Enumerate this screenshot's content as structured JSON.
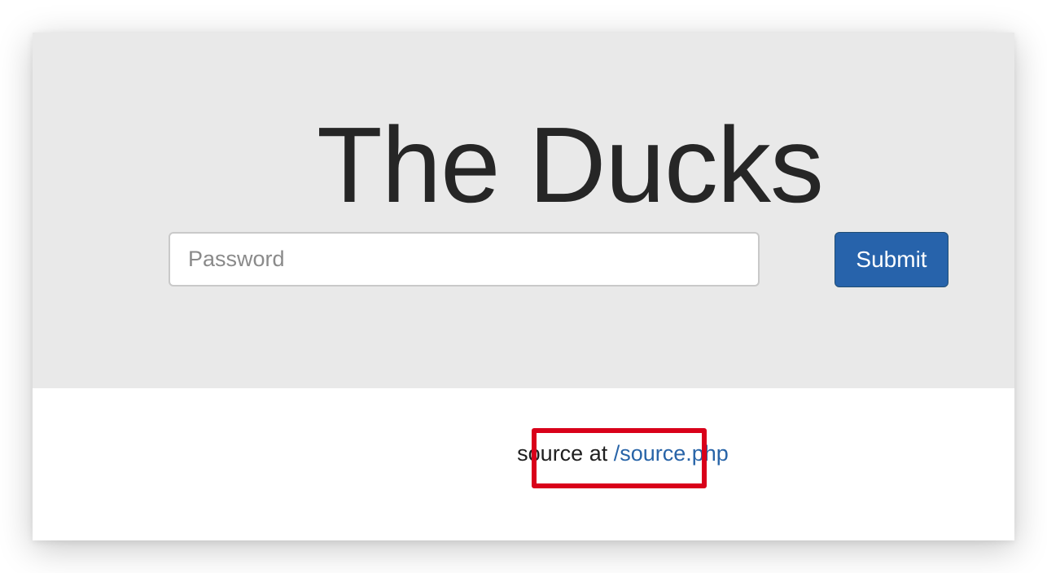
{
  "page": {
    "title": "The Ducks"
  },
  "login_form": {
    "password_placeholder": "Password",
    "password_value": "",
    "submit_label": "Submit"
  },
  "footer": {
    "prefix_text": "source at",
    "link_text": "/source.php"
  },
  "colors": {
    "jumbotron_background": "#e9e9e9",
    "submit_button": "#2763ab",
    "link": "#2864a8",
    "highlight_box": "#d9001a"
  }
}
